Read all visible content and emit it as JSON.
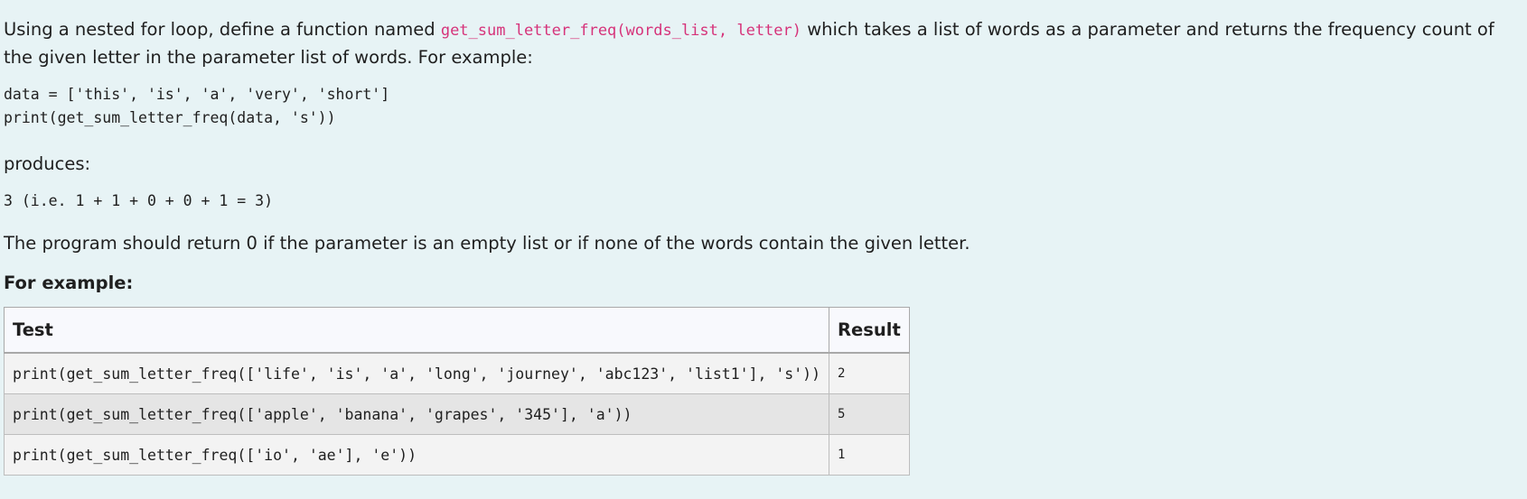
{
  "intro": {
    "before": "Using a nested for loop, define a function named ",
    "signature": "get_sum_letter_freq(words_list, letter)",
    "after": " which takes a list of words as a parameter and returns the frequency count of the given letter in the parameter list of words. For example:"
  },
  "example_code": "data = ['this', 'is', 'a', 'very', 'short']\nprint(get_sum_letter_freq(data, 's'))",
  "produces_label": "produces:",
  "example_output": "3 (i.e. 1 + 1 + 0 + 0 + 1 = 3)",
  "note": "The program should return 0 if the parameter is an empty list or if none of the words contain the given letter.",
  "for_example_label": "For example:",
  "table": {
    "headers": [
      "Test",
      "Result"
    ],
    "rows": [
      {
        "test": "print(get_sum_letter_freq(['life', 'is', 'a', 'long', 'journey', 'abc123', 'list1'], 's'))",
        "result": "2"
      },
      {
        "test": "print(get_sum_letter_freq(['apple', 'banana', 'grapes', '345'], 'a'))",
        "result": "5"
      },
      {
        "test": "print(get_sum_letter_freq(['io', 'ae'], 'e'))",
        "result": "1"
      }
    ]
  }
}
